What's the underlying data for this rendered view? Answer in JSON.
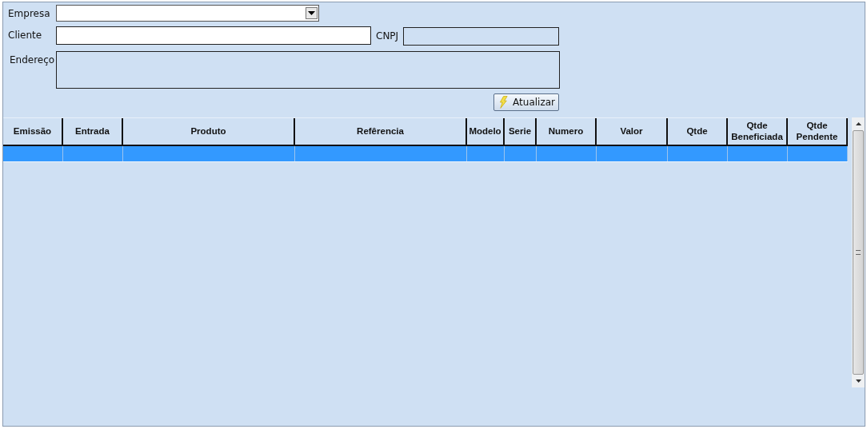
{
  "form": {
    "empresa": {
      "label": "Empresa"
    },
    "cliente": {
      "label": "Cliente"
    },
    "cnpj": {
      "label": "CNPJ",
      "disabled": true
    },
    "endereco": {
      "label": "Endereço",
      "disabled": true
    },
    "refresh_button": {
      "label": "Atualizar"
    }
  },
  "table": {
    "columns": [
      "Emissão",
      "Entrada",
      "Produto",
      "Refêrencia",
      "Modelo",
      "Serie",
      "Numero",
      "Valor",
      "Qtde",
      "Qtde Beneficiada",
      "Qtde Pendente"
    ],
    "rows": [
      {
        "selected": true
      }
    ]
  }
}
